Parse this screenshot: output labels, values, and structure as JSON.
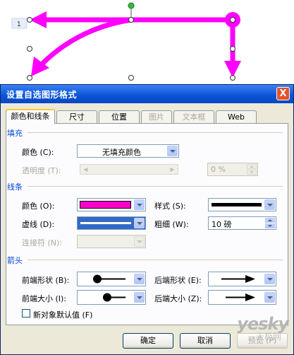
{
  "canvas": {
    "row_label": "1",
    "arrow_color": "#ff00ff"
  },
  "dialog": {
    "title": "设置自选图形格式",
    "close_symbol": "X",
    "tabs": [
      "颜色和线条",
      "尺寸",
      "位置",
      "图片",
      "文本框",
      "Web"
    ],
    "fill": {
      "section": "填充",
      "color_label": "颜色 (C):",
      "color_value": "无填充颜色",
      "transparency_label": "透明度 (T):",
      "transparency_value": "0 %"
    },
    "line": {
      "section": "线条",
      "color_label": "颜色 (O):",
      "color_value": "#ff00cc",
      "style_label": "样式 (S):",
      "dash_label": "虚线 (D):",
      "weight_label": "粗细 (W):",
      "weight_value": "10 磅",
      "connector_label": "连接符 (N):"
    },
    "arrows": {
      "section": "箭头",
      "begin_style_label": "前端形状 (B):",
      "end_style_label": "后端形状 (E):",
      "begin_size_label": "前端大小 (I):",
      "end_size_label": "后端大小 (Z):"
    },
    "default_checkbox": "新对象默认值 (F)",
    "buttons": {
      "ok": "确定",
      "cancel": "取消",
      "preview": "预览 (P)"
    }
  },
  "watermark": {
    "brand": "yesky",
    "site": "天极网"
  }
}
